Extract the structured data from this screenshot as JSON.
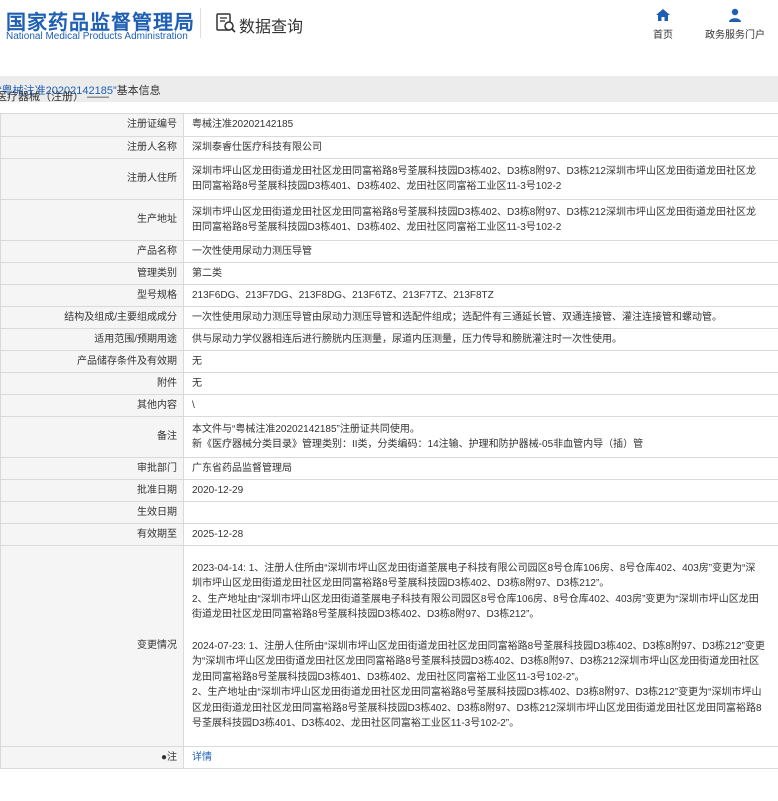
{
  "header": {
    "logo_cn": "国家药品监督管理局",
    "logo_en": "National Medical Products Administration",
    "query_title": "数据查询",
    "nav": {
      "home": "首页",
      "portal": "政务服务门户"
    },
    "colors": {
      "brand": "#1e5fb4"
    }
  },
  "breadcrumb": {
    "prefix": "医疗器械（注册） —— ",
    "highlight": "“粤械注准20202142185”",
    "suffix": "基本信息"
  },
  "rows": [
    {
      "label": "注册证编号",
      "value": "粤械注准20202142185"
    },
    {
      "label": "注册人名称",
      "value": "深圳泰睿仕医疗科技有限公司"
    },
    {
      "label": "注册人住所",
      "value": "深圳市坪山区龙田街道龙田社区龙田同富裕路8号荃展科技园D3栋402、D3栋8附97、D3栋212深圳市坪山区龙田街道龙田社区龙田同富裕路8号荃展科技园D3栋401、D3栋402、龙田社区同富裕工业区11-3号102-2"
    },
    {
      "label": "生产地址",
      "value": "深圳市坪山区龙田街道龙田社区龙田同富裕路8号荃展科技园D3栋402、D3栋8附97、D3栋212深圳市坪山区龙田街道龙田社区龙田同富裕路8号荃展科技园D3栋401、D3栋402、龙田社区同富裕工业区11-3号102-2"
    },
    {
      "label": "产品名称",
      "value": "一次性使用尿动力测压导管"
    },
    {
      "label": "管理类别",
      "value": "第二类"
    },
    {
      "label": "型号规格",
      "value": "213F6DG、213F7DG、213F8DG、213F6TZ、213F7TZ、213F8TZ"
    },
    {
      "label": "结构及组成/主要组成成分",
      "value": "一次性使用尿动力测压导管由尿动力测压导管和选配件组成；选配件有三通延长管、双通连接管、灌注连接管和螺动管。"
    },
    {
      "label": "适用范围/预期用途",
      "value": "供与尿动力学仪器相连后进行膀胱内压测量，尿道内压测量，压力传导和膀胱灌注时一次性使用。"
    },
    {
      "label": "产品储存条件及有效期",
      "value": "无"
    },
    {
      "label": "附件",
      "value": "无"
    },
    {
      "label": "其他内容",
      "value": "\\"
    },
    {
      "label": "备注",
      "lines": [
        "本文件与“粤械注准20202142185”注册证共同使用。",
        "新《医疗器械分类目录》管理类别：II类，分类编码：14注输、护理和防护器械-05非血管内导（插）管"
      ]
    },
    {
      "label": "审批部门",
      "value": "广东省药品监督管理局"
    },
    {
      "label": "批准日期",
      "value": "2020-12-29"
    },
    {
      "label": "生效日期",
      "value": ""
    },
    {
      "label": "有效期至",
      "value": "2025-12-28"
    },
    {
      "label": "变更情况",
      "lines": [
        "2023-04-14: 1、注册人住所由“深圳市坪山区龙田街道荃展电子科技有限公司园区8号仓库106房、8号仓库402、403房”变更为“深圳市坪山区龙田街道龙田社区龙田同富裕路8号荃展科技园D3栋402、D3栋8附97、D3栋212”。",
        "2、生产地址由“深圳市坪山区龙田街道荃展电子科技有限公司园区8号仓库106房、8号仓库402、403房”变更为“深圳市坪山区龙田街道龙田社区龙田同富裕路8号荃展科技园D3栋402、D3栋8附97、D3栋212”。",
        "",
        "2024-07-23: 1、注册人住所由“深圳市坪山区龙田街道龙田社区龙田同富裕路8号荃展科技园D3栋402、D3栋8附97、D3栋212”变更为“深圳市坪山区龙田街道龙田社区龙田同富裕路8号荃展科技园D3栋402、D3栋8附97、D3栋212深圳市坪山区龙田街道龙田社区龙田同富裕路8号荃展科技园D3栋401、D3栋402、龙田社区同富裕工业区11-3号102-2”。",
        "2、生产地址由“深圳市坪山区龙田街道龙田社区龙田同富裕路8号荃展科技园D3栋402、D3栋8附97、D3栋212”变更为“深圳市坪山区龙田街道龙田社区龙田同富裕路8号荃展科技园D3栋402、D3栋8附97、D3栋212深圳市坪山区龙田街道龙田社区龙田同富裕路8号荃展科技园D3栋401、D3栋402、龙田社区同富裕工业区11-3号102-2”。"
      ]
    },
    {
      "label": "●注",
      "link": "详情"
    }
  ]
}
